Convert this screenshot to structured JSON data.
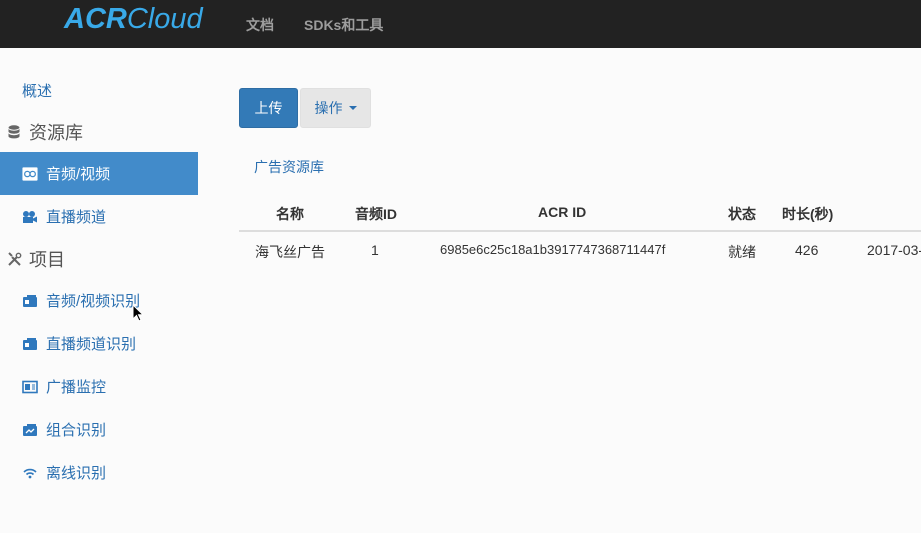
{
  "header": {
    "logo_bold": "ACR",
    "logo_light": "Cloud",
    "nav": [
      "文档",
      "SDKs和工具"
    ]
  },
  "sidebar": {
    "overview": "概述",
    "resources_heading": "资源库",
    "resources": [
      {
        "label": "音频/视频",
        "icon": "media-icon",
        "active": true
      },
      {
        "label": "直播频道",
        "icon": "camera-icon",
        "active": false
      }
    ],
    "projects_heading": "项目",
    "projects": [
      {
        "label": "音频/视频识别",
        "icon": "folder-icon"
      },
      {
        "label": "直播频道识别",
        "icon": "folder-icon"
      },
      {
        "label": "广播监控",
        "icon": "monitor-icon"
      },
      {
        "label": "组合识别",
        "icon": "folder-icon"
      },
      {
        "label": "离线识别",
        "icon": "wifi-icon"
      }
    ]
  },
  "toolbar": {
    "upload_label": "上传",
    "actions_label": "操作"
  },
  "breadcrumb": "广告资源库",
  "table": {
    "headers": [
      "名称",
      "音频ID",
      "ACR ID",
      "状态",
      "时长(秒)"
    ],
    "rows": [
      {
        "name": "海飞丝广告",
        "audio_id": "1",
        "acr_id": "6985e6c25c18a1b3917747368711447f",
        "status": "就绪",
        "duration": "426",
        "date": "2017-03-"
      }
    ]
  },
  "colors": {
    "accent": "#428bca",
    "primary_button": "#337ab7",
    "topbar": "#222222",
    "logo": "#39a9e8"
  }
}
